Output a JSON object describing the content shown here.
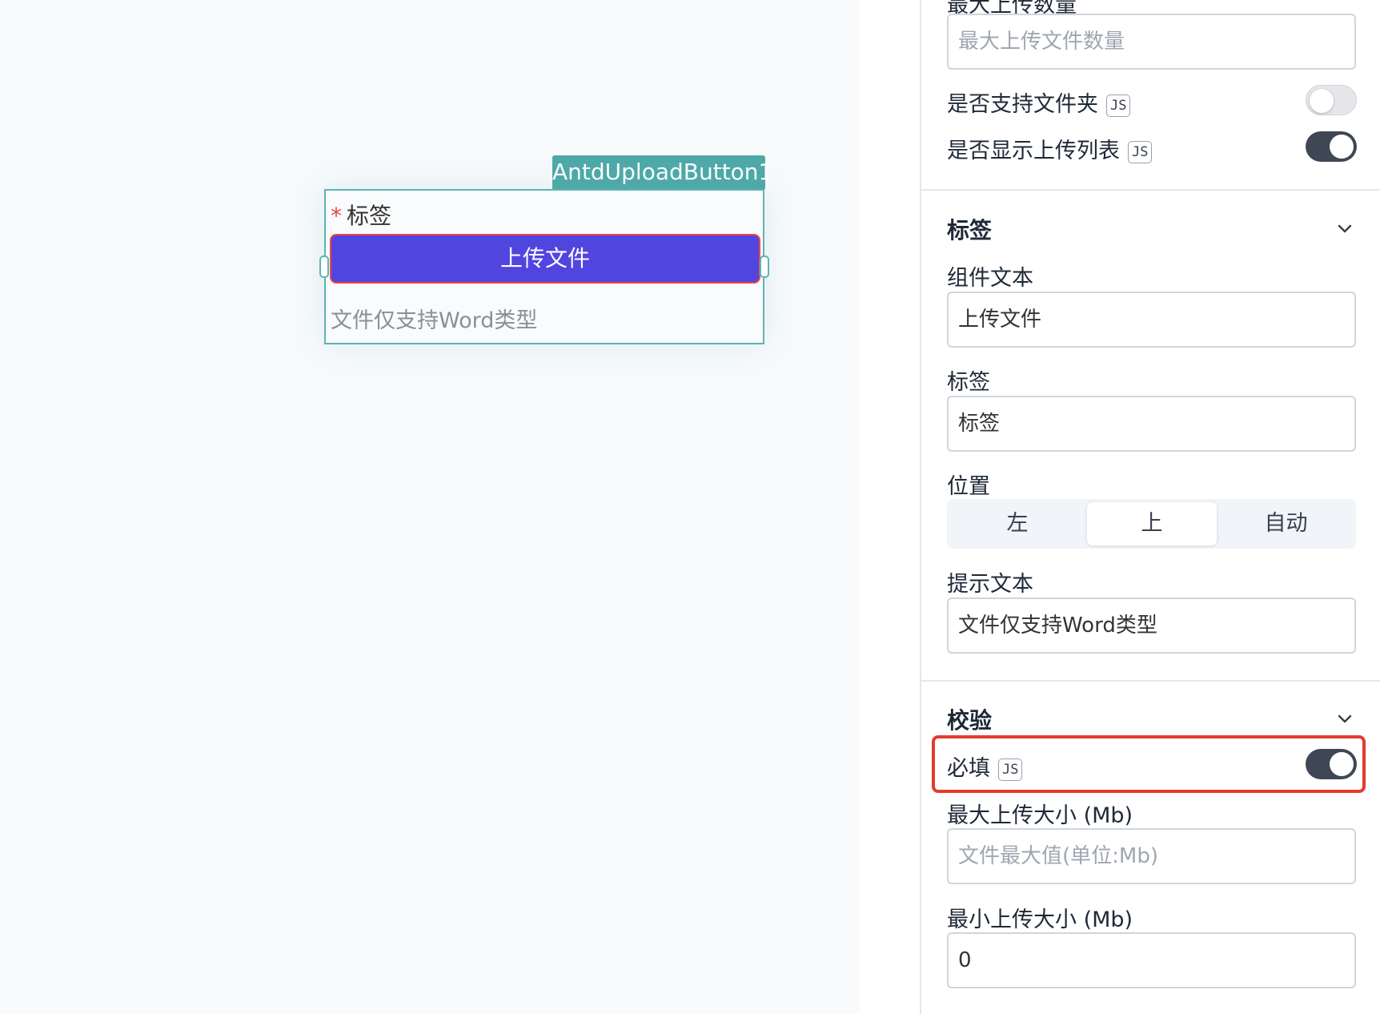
{
  "widget": {
    "name_tag": "AntdUploadButton1",
    "required_mark": "*",
    "label": "标签",
    "button_text": "上传文件",
    "hint": "文件仅支持Word类型"
  },
  "panel": {
    "max_count": {
      "label": "最大上传数量",
      "placeholder": "最大上传文件数量"
    },
    "support_folder": {
      "label": "是否支持文件夹",
      "badge": "JS",
      "enabled": false
    },
    "show_list": {
      "label": "是否显示上传列表",
      "badge": "JS",
      "enabled": true
    },
    "label_section": {
      "title": "标签",
      "component_text": {
        "label": "组件文本",
        "value": "上传文件"
      },
      "label_field": {
        "label": "标签",
        "value": "标签"
      },
      "position": {
        "label": "位置",
        "options": [
          "左",
          "上",
          "自动"
        ],
        "selected": "上"
      },
      "hint_text": {
        "label": "提示文本",
        "value": "文件仅支持Word类型"
      }
    },
    "validation_section": {
      "title": "校验",
      "required": {
        "label": "必填",
        "badge": "JS",
        "enabled": true
      },
      "max_size": {
        "label": "最大上传大小 (Mb)",
        "placeholder": "文件最大值(单位:Mb)"
      },
      "min_size": {
        "label": "最小上传大小 (Mb)",
        "value": "0"
      }
    }
  },
  "colors": {
    "accent": "#5145e0",
    "selection": "#5fb3b3",
    "toggle_on": "#3f4654",
    "highlight": "#e33b2e"
  }
}
